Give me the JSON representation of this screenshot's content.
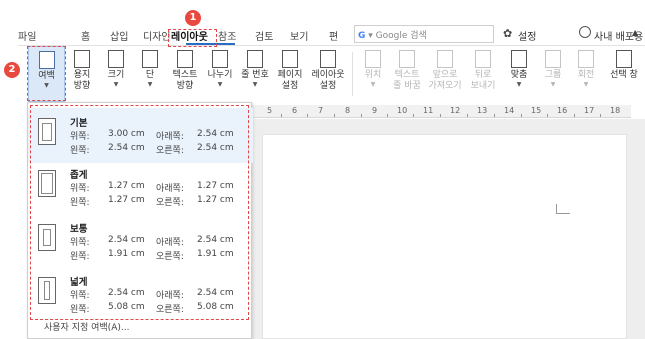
{
  "tabs": [
    "파일",
    "홈",
    "삽입",
    "디자인",
    "레이아웃",
    "참조",
    "검토",
    "보기",
    "편"
  ],
  "active_tab": "레이아웃",
  "search_placeholder": "Google 검색",
  "settings_label": "설정",
  "distribution_label": "사내 배포용",
  "callouts": [
    "1",
    "2"
  ],
  "ribbon": [
    {
      "label": "여백",
      "state": "active"
    },
    {
      "label": "용지\n방향",
      "state": "normal"
    },
    {
      "label": "크기",
      "state": "normal"
    },
    {
      "label": "단",
      "state": "normal"
    },
    {
      "label": "텍스트\n방향",
      "state": "normal"
    },
    {
      "label": "나누기",
      "state": "normal"
    },
    {
      "label": "줄 번호",
      "state": "normal"
    },
    {
      "label": "페이지\n설정",
      "state": "normal"
    },
    {
      "label": "레이아웃\n설정",
      "state": "normal"
    },
    {
      "label": "위치",
      "state": "disabled"
    },
    {
      "label": "텍스트\n줄 바꿈",
      "state": "disabled"
    },
    {
      "label": "앞으로\n가져오기",
      "state": "disabled"
    },
    {
      "label": "뒤로\n보내기",
      "state": "disabled"
    },
    {
      "label": "맞춤",
      "state": "normal"
    },
    {
      "label": "그룹",
      "state": "disabled"
    },
    {
      "label": "회전",
      "state": "disabled"
    },
    {
      "label": "선택 창",
      "state": "normal"
    }
  ],
  "ruler_numbers": [
    "5",
    "6",
    "7",
    "8",
    "9",
    "10",
    "11",
    "12",
    "13",
    "14",
    "15",
    "16",
    "17",
    "18"
  ],
  "margin_presets": [
    {
      "name": "기본",
      "top_label": "위쪽:",
      "top": "3.00 cm",
      "bottom_label": "아래쪽:",
      "bottom": "2.54 cm",
      "left_label": "왼쪽:",
      "left": "2.54 cm",
      "right_label": "오른쪽:",
      "right": "2.54 cm"
    },
    {
      "name": "좁게",
      "top_label": "위쪽:",
      "top": "1.27 cm",
      "bottom_label": "아래쪽:",
      "bottom": "1.27 cm",
      "left_label": "왼쪽:",
      "left": "1.27 cm",
      "right_label": "오른쪽:",
      "right": "1.27 cm"
    },
    {
      "name": "보통",
      "top_label": "위쪽:",
      "top": "2.54 cm",
      "bottom_label": "아래쪽:",
      "bottom": "2.54 cm",
      "left_label": "왼쪽:",
      "left": "1.91 cm",
      "right_label": "오른쪽:",
      "right": "1.91 cm"
    },
    {
      "name": "넓게",
      "top_label": "위쪽:",
      "top": "2.54 cm",
      "bottom_label": "아래쪽:",
      "bottom": "2.54 cm",
      "left_label": "왼쪽:",
      "left": "5.08 cm",
      "right_label": "오른쪽:",
      "right": "5.08 cm"
    }
  ],
  "custom_margin_label": "사용자 지정 여백(A)...",
  "colors": {
    "accent": "#2b6cc4",
    "highlight": "#e24848",
    "selected": "#dbe8f7"
  }
}
